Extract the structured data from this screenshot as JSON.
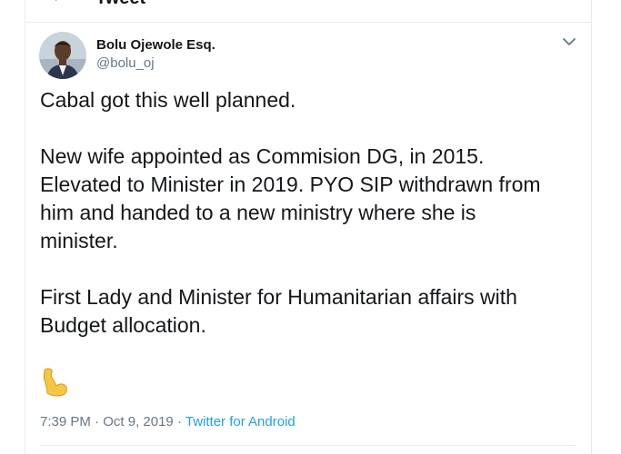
{
  "header": {
    "title": "Tweet"
  },
  "tweet": {
    "author_name": "Bolu Ojewole Esq.",
    "author_handle": "@bolu_oj",
    "paragraphs": [
      "Cabal got this well planned.",
      "New wife appointed as Commision DG, in 2015.\nElevated to Minister in 2019. PYO SIP withdrawn from\nhim and handed to a new ministry where she is\nminister.",
      "First Lady and Minister for Humanitarian affairs with\nBudget allocation."
    ],
    "emoji": "flexed-biceps",
    "time": "7:39 PM",
    "date": "Oct 9, 2019",
    "separator": "·",
    "source": "Twitter for Android"
  },
  "colors": {
    "accent": "#1da1f2",
    "text": "#14171a",
    "secondary": "#657786",
    "border": "#e6ecf0"
  }
}
